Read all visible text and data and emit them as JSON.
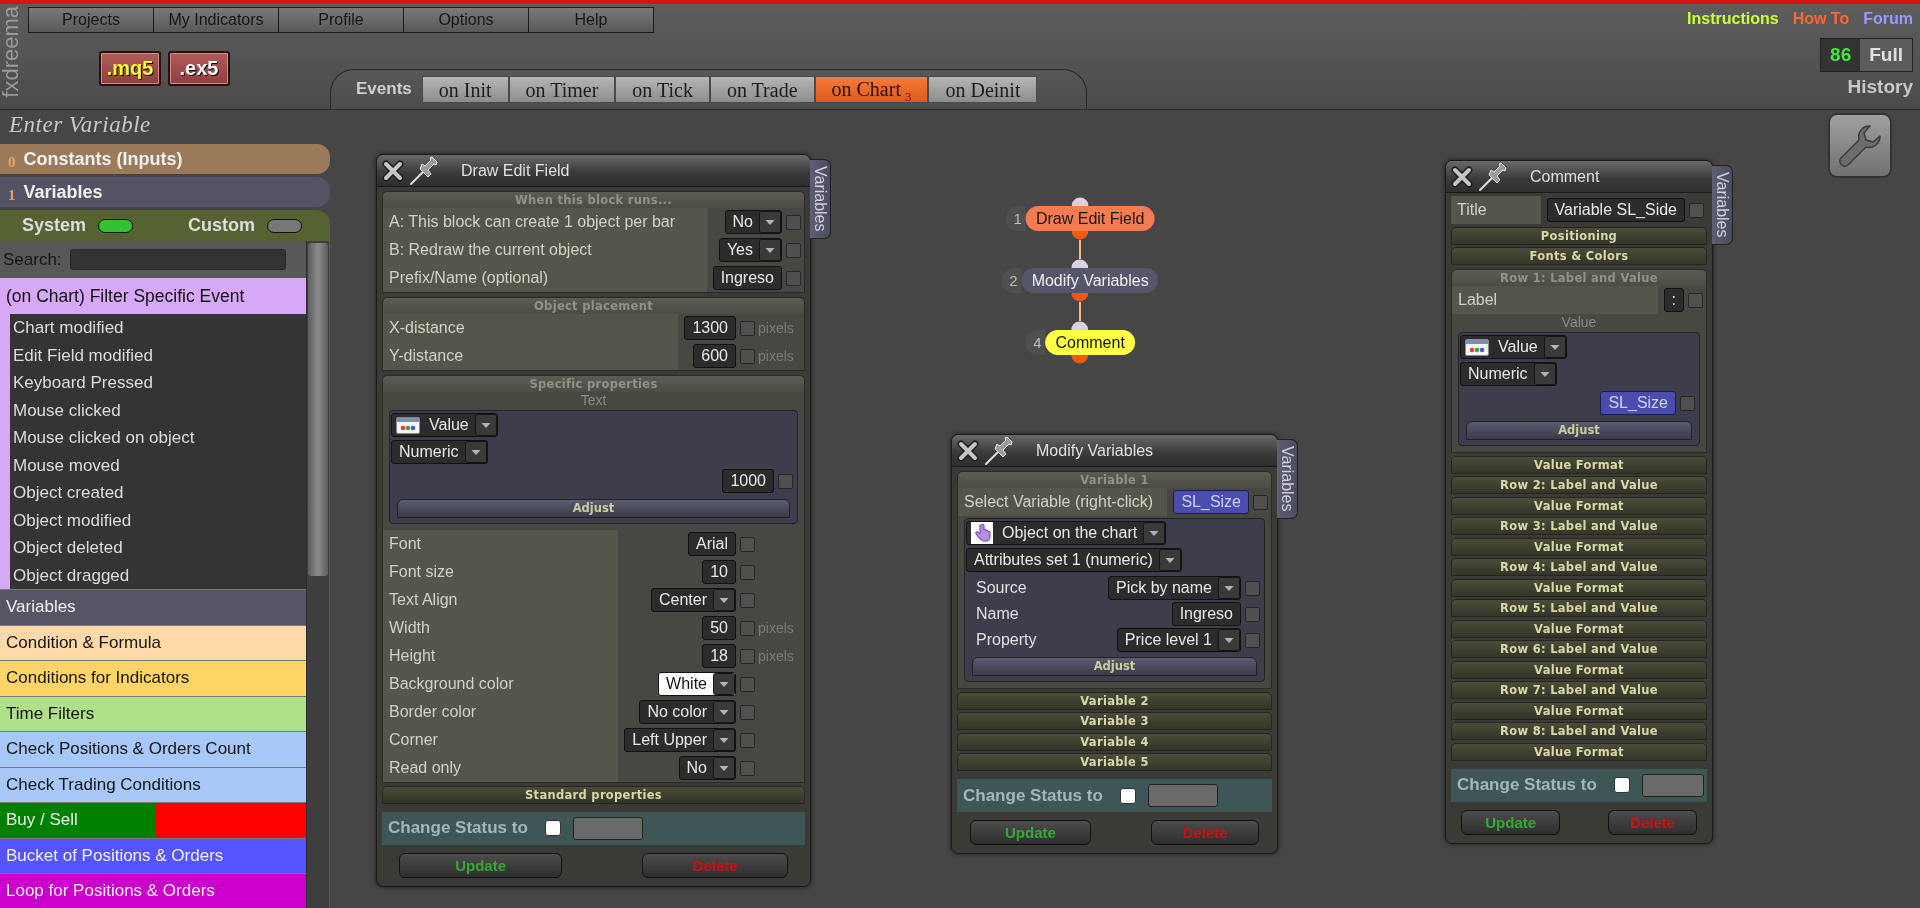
{
  "header": {
    "brand": "fxdreema",
    "menu": [
      "Projects",
      "My Indicators",
      "Profile",
      "Options",
      "Help"
    ],
    "file_buttons": [
      {
        "label": ".mq5",
        "kind": "source"
      },
      {
        "label": ".ex5",
        "kind": "compiled"
      }
    ],
    "links": [
      {
        "label": "Instructions",
        "color": "#ccff33"
      },
      {
        "label": "How To",
        "color": "#ff6633"
      },
      {
        "label": "Forum",
        "color": "#9999ff"
      }
    ],
    "history": {
      "count": "86",
      "mode": "Full",
      "label": "History"
    }
  },
  "events": {
    "label": "Events",
    "tabs": [
      {
        "label": "on Init",
        "selected": false
      },
      {
        "label": "on Timer",
        "selected": false
      },
      {
        "label": "on Tick",
        "selected": false
      },
      {
        "label": "on Trade",
        "selected": false
      },
      {
        "label": "on Chart",
        "count": "3",
        "selected": true
      },
      {
        "label": "on Deinit",
        "selected": false
      }
    ]
  },
  "sidebar": {
    "heading": "Enter Variable",
    "sections": [
      {
        "number": "0",
        "label": "Constants (Inputs)",
        "color": "#9b7a5a"
      },
      {
        "number": "1",
        "label": "Variables",
        "color": "#535365"
      }
    ],
    "toggles": [
      {
        "label": "System",
        "on": true
      },
      {
        "label": "Custom",
        "on": false
      }
    ],
    "search": {
      "label": "Search:"
    },
    "filter": {
      "title": "(on Chart) Filter Specific Event",
      "items": [
        "Chart modified",
        "Edit Field modified",
        "Keyboard Pressed",
        "Mouse clicked",
        "Mouse clicked on object",
        "Mouse moved",
        "Object created",
        "Object modified",
        "Object deleted",
        "Object dragged"
      ]
    },
    "categories": [
      {
        "label": "Variables",
        "color": "#555566"
      },
      {
        "label": "Condition & Formula",
        "color": "#fdd9a8"
      },
      {
        "label": "Conditions for Indicators",
        "color": "#ffd466"
      },
      {
        "label": "Time Filters",
        "color": "#b0e08a"
      },
      {
        "label": "Check Positions & Orders Count",
        "color": "#a8c8fa"
      },
      {
        "label": "Check Trading Conditions",
        "color": "#a8c8fa"
      },
      {
        "label": "Buy / Sell",
        "color": "#008000",
        "right_half": {
          "color": "#ff0000"
        }
      },
      {
        "label": "Bucket of Positions & Orders",
        "color": "#5555ff"
      },
      {
        "label": "Loop for Positions & Orders",
        "color": "#cc00cc"
      }
    ]
  },
  "canvas": {
    "nodes": [
      {
        "number": "1",
        "label": "Draw Edit Field",
        "color": "#f47c50"
      },
      {
        "number": "2",
        "label": "Modify Variables",
        "color": "#56566a"
      },
      {
        "number": "4",
        "label": "Comment",
        "color": "#ffff44"
      }
    ],
    "panels": [
      {
        "title": "Draw Edit Field",
        "side_tab": "Variables",
        "blocks": [
          {
            "kind": "section",
            "label": "When this block runs...",
            "expanded": true,
            "blocks": [
              {
                "kind": "rows",
                "rows": [
                  {
                    "label": "A: This block can create 1 object per bar",
                    "control": {
                      "kind": "select",
                      "value": "No"
                    },
                    "checked": false
                  },
                  {
                    "label": "B: Redraw the current object",
                    "control": {
                      "kind": "select",
                      "value": "Yes"
                    },
                    "checked": false
                  },
                  {
                    "label": "Prefix/Name (optional)",
                    "control": {
                      "kind": "input",
                      "value": "Ingreso"
                    },
                    "checked": false
                  }
                ]
              }
            ]
          },
          {
            "kind": "section",
            "label": "Object placement",
            "expanded": true,
            "blocks": [
              {
                "kind": "rows",
                "rows": [
                  {
                    "label": "X-distance",
                    "control": {
                      "kind": "input",
                      "value": "1300"
                    },
                    "checked": false,
                    "unit": "pixels"
                  },
                  {
                    "label": "Y-distance",
                    "control": {
                      "kind": "input",
                      "value": "600"
                    },
                    "checked": false,
                    "unit": "pixels"
                  }
                ]
              }
            ]
          },
          {
            "kind": "section",
            "label": "Specific properties",
            "expanded": true,
            "blocks": [
              {
                "kind": "caption",
                "label": "Text"
              },
              {
                "kind": "box",
                "selects": [
                  {
                    "kind": "value",
                    "value": "Value"
                  },
                  {
                    "kind": "plain",
                    "value": "Numeric"
                  }
                ],
                "rows": [
                  {
                    "control": {
                      "kind": "input",
                      "value": "1000"
                    },
                    "checked": false
                  }
                ],
                "adjust": "Adjust"
              },
              {
                "kind": "rows",
                "rows": [
                  {
                    "label": "Font",
                    "control": {
                      "kind": "input",
                      "value": "Arial"
                    },
                    "checked": false
                  },
                  {
                    "label": "Font size",
                    "control": {
                      "kind": "input",
                      "value": "10"
                    },
                    "checked": false
                  },
                  {
                    "label": "Text Align",
                    "control": {
                      "kind": "select",
                      "value": "Center"
                    },
                    "checked": false
                  },
                  {
                    "label": "Width",
                    "control": {
                      "kind": "input",
                      "value": "50"
                    },
                    "checked": false,
                    "unit": "pixels"
                  },
                  {
                    "label": "Height",
                    "control": {
                      "kind": "input",
                      "value": "18"
                    },
                    "checked": false,
                    "unit": "pixels"
                  },
                  {
                    "label": "Background color",
                    "control": {
                      "kind": "select",
                      "value": "White",
                      "color": "#ffffff"
                    },
                    "checked": false
                  },
                  {
                    "label": "Border color",
                    "control": {
                      "kind": "select",
                      "value": "No color"
                    },
                    "checked": false
                  },
                  {
                    "label": "Corner",
                    "control": {
                      "kind": "select",
                      "value": "Left Upper"
                    },
                    "checked": false
                  },
                  {
                    "label": "Read only",
                    "control": {
                      "kind": "select",
                      "value": "No"
                    },
                    "checked": false
                  }
                ]
              }
            ]
          },
          {
            "kind": "section",
            "label": "Standard properties",
            "expanded": false
          }
        ],
        "status": {
          "label": "Change Status to",
          "checked": false
        },
        "buttons": [
          {
            "label": "Update",
            "kind": "update"
          },
          {
            "label": "Delete",
            "kind": "delete"
          }
        ]
      },
      {
        "title": "Modify Variables",
        "side_tab": "Variables",
        "blocks": [
          {
            "kind": "section",
            "label": "Variable 1",
            "expanded": true,
            "blocks": [
              {
                "kind": "rows",
                "rows": [
                  {
                    "label": "Select Variable (right-click)",
                    "control": {
                      "kind": "variable",
                      "value": "SL_Size"
                    },
                    "checked": false
                  }
                ]
              },
              {
                "kind": "box",
                "selects": [
                  {
                    "kind": "object",
                    "value": "Object on the chart"
                  },
                  {
                    "kind": "plain",
                    "value": "Attributes set 1 (numeric)"
                  }
                ],
                "rows": [
                  {
                    "label": "Source",
                    "control": {
                      "kind": "select",
                      "value": "Pick by name"
                    },
                    "checked": false
                  },
                  {
                    "label": "Name",
                    "control": {
                      "kind": "input",
                      "value": "Ingreso"
                    },
                    "checked": false
                  },
                  {
                    "label": "Property",
                    "control": {
                      "kind": "select",
                      "value": "Price level 1"
                    },
                    "checked": false
                  }
                ],
                "adjust": "Adjust"
              }
            ]
          },
          {
            "kind": "section",
            "label": "Variable 2",
            "expanded": false
          },
          {
            "kind": "section",
            "label": "Variable 3",
            "expanded": false
          },
          {
            "kind": "section",
            "label": "Variable 4",
            "expanded": false
          },
          {
            "kind": "section",
            "label": "Variable 5",
            "expanded": false
          }
        ],
        "status": {
          "label": "Change Status to",
          "checked": false
        },
        "buttons": [
          {
            "label": "Update",
            "kind": "update"
          },
          {
            "label": "Delete",
            "kind": "delete"
          }
        ]
      },
      {
        "title": "Comment",
        "side_tab": "Variables",
        "blocks": [
          {
            "kind": "rows",
            "rows": [
              {
                "label": "Title",
                "control": {
                  "kind": "input",
                  "value": "Variable SL_Side"
                },
                "checked": false
              }
            ]
          },
          {
            "kind": "section",
            "label": "Positioning",
            "expanded": false
          },
          {
            "kind": "section",
            "label": "Fonts & Colors",
            "expanded": false
          },
          {
            "kind": "section",
            "label": "Row 1: Label and Value",
            "expanded": true,
            "blocks": [
              {
                "kind": "rows",
                "rows": [
                  {
                    "label": "Label",
                    "control": {
                      "kind": "input",
                      "value": ":"
                    },
                    "checked": false
                  }
                ]
              },
              {
                "kind": "caption",
                "label": "Value"
              },
              {
                "kind": "box",
                "selects": [
                  {
                    "kind": "value",
                    "value": "Value"
                  },
                  {
                    "kind": "plain",
                    "value": "Numeric"
                  }
                ],
                "rows": [
                  {
                    "control": {
                      "kind": "variable",
                      "value": "SL_Size"
                    },
                    "checked": false
                  }
                ],
                "adjust": "Adjust"
              }
            ]
          },
          {
            "kind": "section",
            "label": "Value Format",
            "expanded": false
          },
          {
            "kind": "section",
            "label": "Row 2: Label and Value",
            "expanded": false
          },
          {
            "kind": "section",
            "label": "Value Format",
            "expanded": false
          },
          {
            "kind": "section",
            "label": "Row 3: Label and Value",
            "expanded": false
          },
          {
            "kind": "section",
            "label": "Value Format",
            "expanded": false
          },
          {
            "kind": "section",
            "label": "Row 4: Label and Value",
            "expanded": false
          },
          {
            "kind": "section",
            "label": "Value Format",
            "expanded": false
          },
          {
            "kind": "section",
            "label": "Row 5: Label and Value",
            "expanded": false
          },
          {
            "kind": "section",
            "label": "Value Format",
            "expanded": false
          },
          {
            "kind": "section",
            "label": "Row 6: Label and Value",
            "expanded": false
          },
          {
            "kind": "section",
            "label": "Value Format",
            "expanded": false
          },
          {
            "kind": "section",
            "label": "Row 7: Label and Value",
            "expanded": false
          },
          {
            "kind": "section",
            "label": "Value Format",
            "expanded": false
          },
          {
            "kind": "section",
            "label": "Row 8: Label and Value",
            "expanded": false
          },
          {
            "kind": "section",
            "label": "Value Format",
            "expanded": false
          }
        ],
        "status": {
          "label": "Change Status to",
          "checked": false
        },
        "buttons": [
          {
            "label": "Update",
            "kind": "update"
          },
          {
            "label": "Delete",
            "kind": "delete"
          }
        ]
      }
    ]
  }
}
